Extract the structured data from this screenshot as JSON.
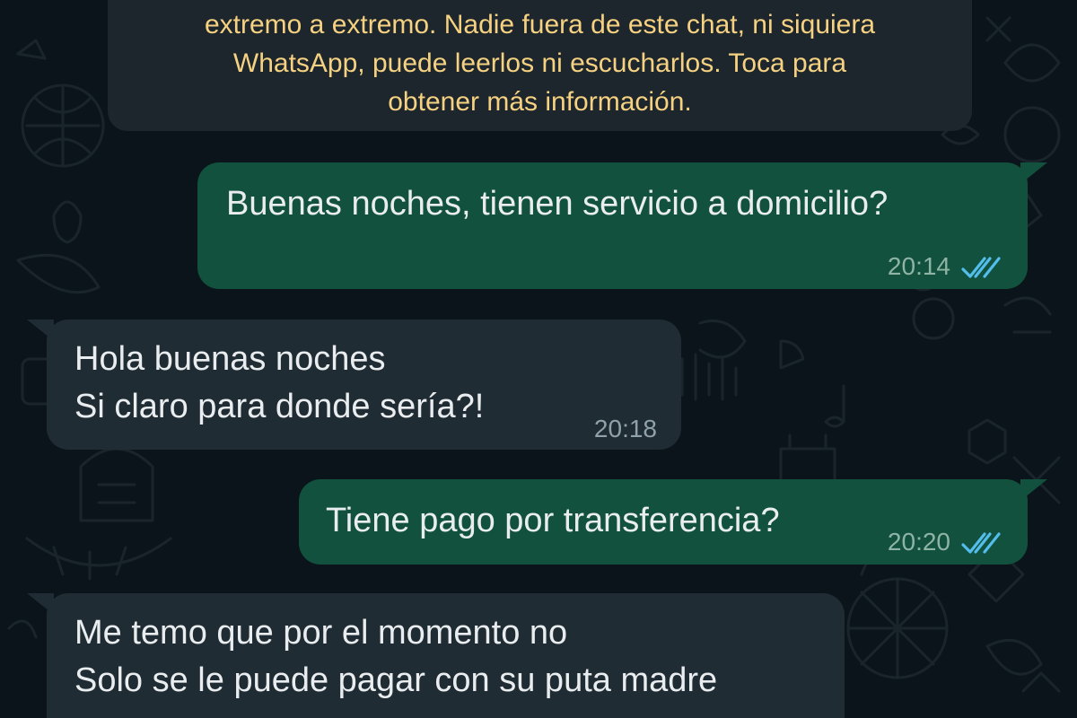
{
  "encryption_notice": {
    "lines": [
      "extremo a extremo. Nadie fuera de este chat, ni siquiera",
      "WhatsApp, puede leerlos ni escucharlos. Toca para",
      "obtener más información."
    ],
    "color": "#f6d181"
  },
  "messages": [
    {
      "direction": "outgoing",
      "lines": [
        "Buenas noches, tienen servicio a domicilio?"
      ],
      "time": "20:14",
      "status": "read",
      "status_icon": "double-check-icon"
    },
    {
      "direction": "incoming",
      "lines": [
        "Hola buenas noches",
        "Si claro para donde sería?!"
      ],
      "time": "20:18"
    },
    {
      "direction": "outgoing",
      "lines": [
        "Tiene pago por transferencia?"
      ],
      "time": "20:20",
      "status": "read",
      "status_icon": "double-check-icon"
    },
    {
      "direction": "incoming",
      "lines": [
        "Me temo que por el momento no",
        "Solo se le puede pagar con su puta madre"
      ],
      "time": ""
    }
  ],
  "colors": {
    "background": "#0b141a",
    "incoming_bubble": "#202c33",
    "outgoing_bubble": "#11513d",
    "read_ticks": "#53bdeb",
    "notice_text": "#f6d181"
  }
}
